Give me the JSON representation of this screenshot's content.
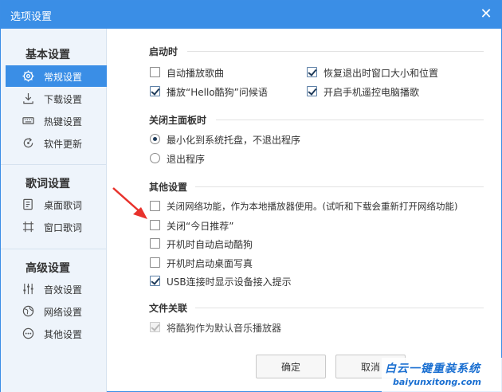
{
  "window": {
    "title": "选项设置",
    "close_glyph": "✕"
  },
  "sidebar": {
    "groups": [
      {
        "title": "基本设置",
        "items": [
          {
            "label": "常规设置",
            "icon": "gear-icon",
            "active": true
          },
          {
            "label": "下载设置",
            "icon": "download-icon",
            "active": false
          },
          {
            "label": "热键设置",
            "icon": "keyboard-icon",
            "active": false
          },
          {
            "label": "软件更新",
            "icon": "refresh-icon",
            "active": false
          }
        ]
      },
      {
        "title": "歌词设置",
        "items": [
          {
            "label": "桌面歌词",
            "icon": "desktop-lyrics-icon",
            "active": false
          },
          {
            "label": "窗口歌词",
            "icon": "window-lyrics-icon",
            "active": false
          }
        ]
      },
      {
        "title": "高级设置",
        "items": [
          {
            "label": "音效设置",
            "icon": "equalizer-icon",
            "active": false
          },
          {
            "label": "网络设置",
            "icon": "globe-icon",
            "active": false
          },
          {
            "label": "其他设置",
            "icon": "more-icon",
            "active": false
          }
        ]
      }
    ]
  },
  "sections": {
    "startup": {
      "title": "启动时",
      "options": [
        {
          "label": "自动播放歌曲",
          "checked": false
        },
        {
          "label": "恢复退出时窗口大小和位置",
          "checked": true
        },
        {
          "label": "播放“Hello酷狗”问候语",
          "checked": true
        },
        {
          "label": "开启手机遥控电脑播歌",
          "checked": true
        }
      ]
    },
    "close_panel": {
      "title": "关闭主面板时",
      "options": [
        {
          "label": "最小化到系统托盘，不退出程序",
          "checked": true
        },
        {
          "label": "退出程序",
          "checked": false
        }
      ]
    },
    "other": {
      "title": "其他设置",
      "options": [
        {
          "label": "关闭网络功能，作为本地播放器使用。(试听和下载会重新打开网络功能)",
          "checked": false
        },
        {
          "label": "关闭“今日推荐”",
          "checked": false
        },
        {
          "label": "开机时自动启动酷狗",
          "checked": false
        },
        {
          "label": "开机时启动桌面写真",
          "checked": false
        },
        {
          "label": "USB连接时显示设备接入提示",
          "checked": true
        }
      ]
    },
    "file_assoc": {
      "title": "文件关联",
      "options": [
        {
          "label": "将酷狗作为默认音乐播放器",
          "checked": true,
          "disabled": true
        }
      ]
    }
  },
  "buttons": {
    "ok": "确定",
    "cancel": "取消"
  },
  "watermark": {
    "title": "白云一键重装系统",
    "url": "baiyunxitong.com"
  },
  "colors": {
    "accent": "#3a8ee6",
    "annotation_arrow": "#e8322c"
  }
}
